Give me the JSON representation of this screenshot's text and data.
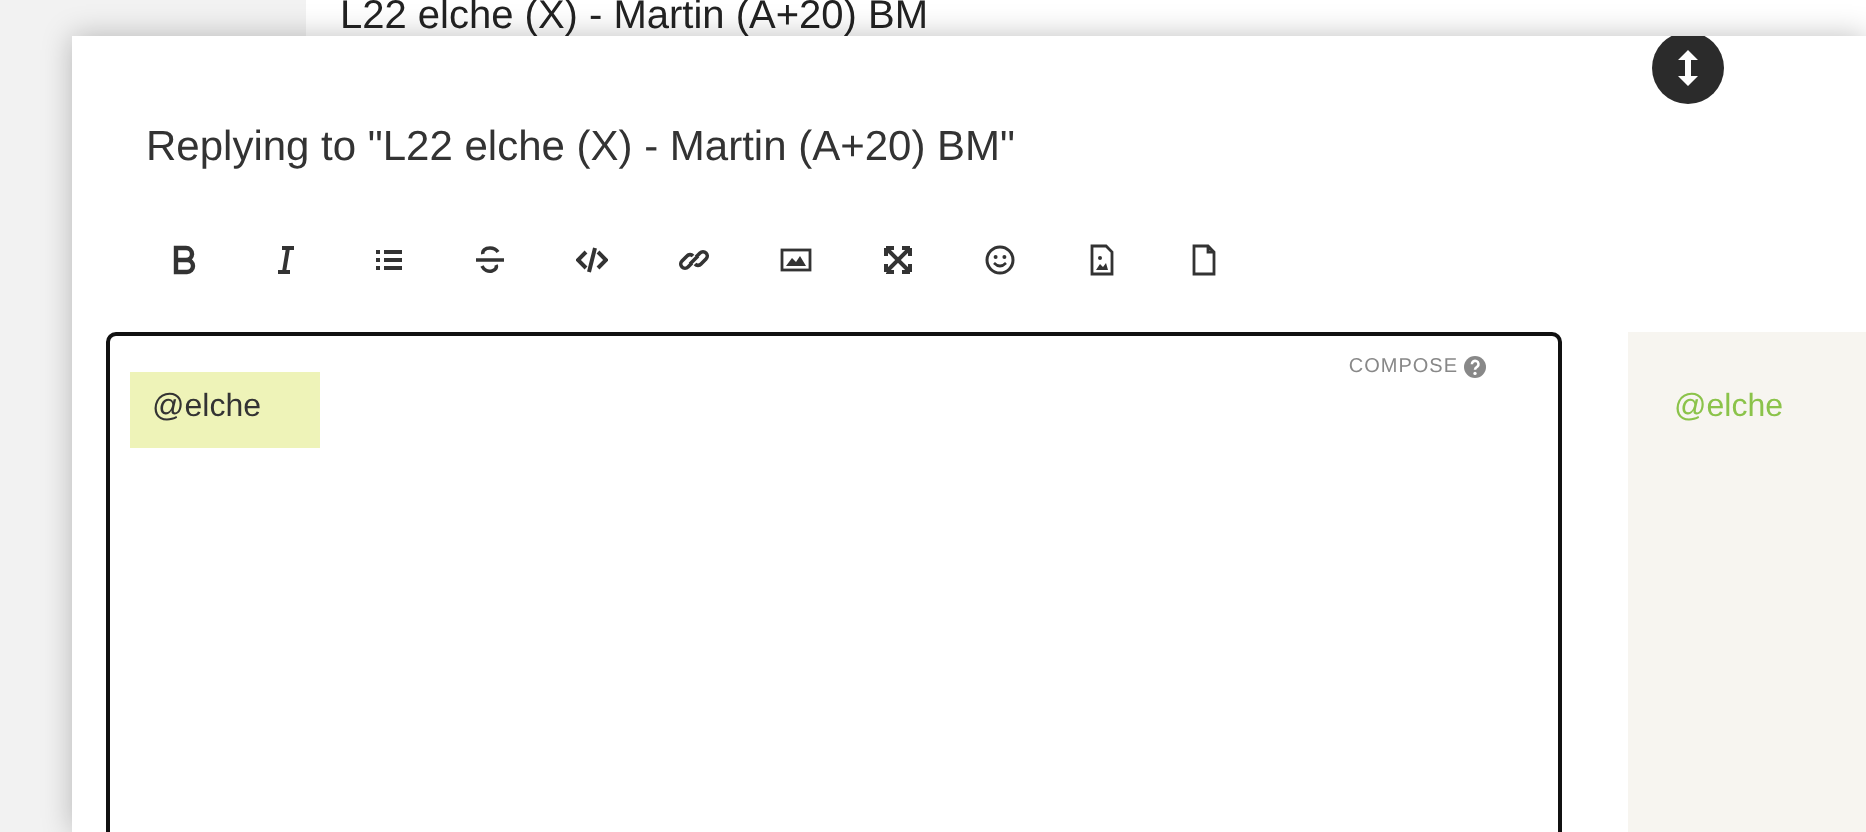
{
  "topic_title": "L22 elche (X) - Martin (A+20) BM",
  "composer": {
    "title": "Replying to \"L22 elche (X) - Martin (A+20) BM\"",
    "toolbar": [
      {
        "kind": "bold"
      },
      {
        "kind": "italic"
      },
      {
        "kind": "list"
      },
      {
        "kind": "strike"
      },
      {
        "kind": "code"
      },
      {
        "kind": "link"
      },
      {
        "kind": "image"
      },
      {
        "kind": "fullscreen"
      },
      {
        "kind": "emoji"
      },
      {
        "kind": "upload"
      },
      {
        "kind": "file"
      }
    ],
    "editor": {
      "mode_label": "COMPOSE",
      "value": "@elche"
    },
    "preview": {
      "text": "@elche"
    }
  }
}
